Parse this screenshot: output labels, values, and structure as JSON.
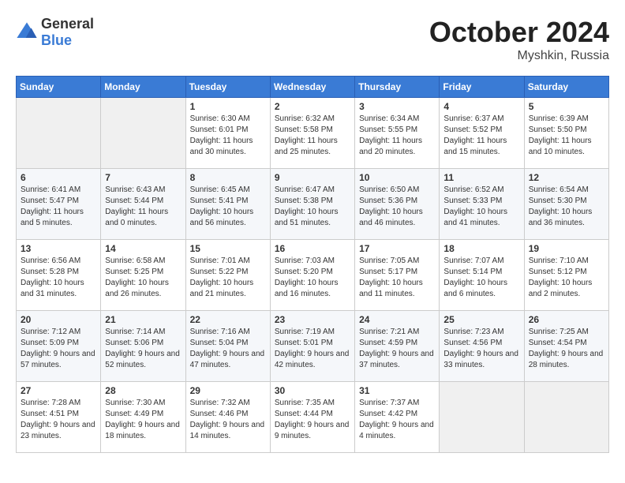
{
  "header": {
    "logo_general": "General",
    "logo_blue": "Blue",
    "month": "October 2024",
    "location": "Myshkin, Russia"
  },
  "days_of_week": [
    "Sunday",
    "Monday",
    "Tuesday",
    "Wednesday",
    "Thursday",
    "Friday",
    "Saturday"
  ],
  "weeks": [
    [
      {
        "day": "",
        "empty": true
      },
      {
        "day": "",
        "empty": true
      },
      {
        "day": "1",
        "sunrise": "Sunrise: 6:30 AM",
        "sunset": "Sunset: 6:01 PM",
        "daylight": "Daylight: 11 hours and 30 minutes."
      },
      {
        "day": "2",
        "sunrise": "Sunrise: 6:32 AM",
        "sunset": "Sunset: 5:58 PM",
        "daylight": "Daylight: 11 hours and 25 minutes."
      },
      {
        "day": "3",
        "sunrise": "Sunrise: 6:34 AM",
        "sunset": "Sunset: 5:55 PM",
        "daylight": "Daylight: 11 hours and 20 minutes."
      },
      {
        "day": "4",
        "sunrise": "Sunrise: 6:37 AM",
        "sunset": "Sunset: 5:52 PM",
        "daylight": "Daylight: 11 hours and 15 minutes."
      },
      {
        "day": "5",
        "sunrise": "Sunrise: 6:39 AM",
        "sunset": "Sunset: 5:50 PM",
        "daylight": "Daylight: 11 hours and 10 minutes."
      }
    ],
    [
      {
        "day": "6",
        "sunrise": "Sunrise: 6:41 AM",
        "sunset": "Sunset: 5:47 PM",
        "daylight": "Daylight: 11 hours and 5 minutes."
      },
      {
        "day": "7",
        "sunrise": "Sunrise: 6:43 AM",
        "sunset": "Sunset: 5:44 PM",
        "daylight": "Daylight: 11 hours and 0 minutes."
      },
      {
        "day": "8",
        "sunrise": "Sunrise: 6:45 AM",
        "sunset": "Sunset: 5:41 PM",
        "daylight": "Daylight: 10 hours and 56 minutes."
      },
      {
        "day": "9",
        "sunrise": "Sunrise: 6:47 AM",
        "sunset": "Sunset: 5:38 PM",
        "daylight": "Daylight: 10 hours and 51 minutes."
      },
      {
        "day": "10",
        "sunrise": "Sunrise: 6:50 AM",
        "sunset": "Sunset: 5:36 PM",
        "daylight": "Daylight: 10 hours and 46 minutes."
      },
      {
        "day": "11",
        "sunrise": "Sunrise: 6:52 AM",
        "sunset": "Sunset: 5:33 PM",
        "daylight": "Daylight: 10 hours and 41 minutes."
      },
      {
        "day": "12",
        "sunrise": "Sunrise: 6:54 AM",
        "sunset": "Sunset: 5:30 PM",
        "daylight": "Daylight: 10 hours and 36 minutes."
      }
    ],
    [
      {
        "day": "13",
        "sunrise": "Sunrise: 6:56 AM",
        "sunset": "Sunset: 5:28 PM",
        "daylight": "Daylight: 10 hours and 31 minutes."
      },
      {
        "day": "14",
        "sunrise": "Sunrise: 6:58 AM",
        "sunset": "Sunset: 5:25 PM",
        "daylight": "Daylight: 10 hours and 26 minutes."
      },
      {
        "day": "15",
        "sunrise": "Sunrise: 7:01 AM",
        "sunset": "Sunset: 5:22 PM",
        "daylight": "Daylight: 10 hours and 21 minutes."
      },
      {
        "day": "16",
        "sunrise": "Sunrise: 7:03 AM",
        "sunset": "Sunset: 5:20 PM",
        "daylight": "Daylight: 10 hours and 16 minutes."
      },
      {
        "day": "17",
        "sunrise": "Sunrise: 7:05 AM",
        "sunset": "Sunset: 5:17 PM",
        "daylight": "Daylight: 10 hours and 11 minutes."
      },
      {
        "day": "18",
        "sunrise": "Sunrise: 7:07 AM",
        "sunset": "Sunset: 5:14 PM",
        "daylight": "Daylight: 10 hours and 6 minutes."
      },
      {
        "day": "19",
        "sunrise": "Sunrise: 7:10 AM",
        "sunset": "Sunset: 5:12 PM",
        "daylight": "Daylight: 10 hours and 2 minutes."
      }
    ],
    [
      {
        "day": "20",
        "sunrise": "Sunrise: 7:12 AM",
        "sunset": "Sunset: 5:09 PM",
        "daylight": "Daylight: 9 hours and 57 minutes."
      },
      {
        "day": "21",
        "sunrise": "Sunrise: 7:14 AM",
        "sunset": "Sunset: 5:06 PM",
        "daylight": "Daylight: 9 hours and 52 minutes."
      },
      {
        "day": "22",
        "sunrise": "Sunrise: 7:16 AM",
        "sunset": "Sunset: 5:04 PM",
        "daylight": "Daylight: 9 hours and 47 minutes."
      },
      {
        "day": "23",
        "sunrise": "Sunrise: 7:19 AM",
        "sunset": "Sunset: 5:01 PM",
        "daylight": "Daylight: 9 hours and 42 minutes."
      },
      {
        "day": "24",
        "sunrise": "Sunrise: 7:21 AM",
        "sunset": "Sunset: 4:59 PM",
        "daylight": "Daylight: 9 hours and 37 minutes."
      },
      {
        "day": "25",
        "sunrise": "Sunrise: 7:23 AM",
        "sunset": "Sunset: 4:56 PM",
        "daylight": "Daylight: 9 hours and 33 minutes."
      },
      {
        "day": "26",
        "sunrise": "Sunrise: 7:25 AM",
        "sunset": "Sunset: 4:54 PM",
        "daylight": "Daylight: 9 hours and 28 minutes."
      }
    ],
    [
      {
        "day": "27",
        "sunrise": "Sunrise: 7:28 AM",
        "sunset": "Sunset: 4:51 PM",
        "daylight": "Daylight: 9 hours and 23 minutes."
      },
      {
        "day": "28",
        "sunrise": "Sunrise: 7:30 AM",
        "sunset": "Sunset: 4:49 PM",
        "daylight": "Daylight: 9 hours and 18 minutes."
      },
      {
        "day": "29",
        "sunrise": "Sunrise: 7:32 AM",
        "sunset": "Sunset: 4:46 PM",
        "daylight": "Daylight: 9 hours and 14 minutes."
      },
      {
        "day": "30",
        "sunrise": "Sunrise: 7:35 AM",
        "sunset": "Sunset: 4:44 PM",
        "daylight": "Daylight: 9 hours and 9 minutes."
      },
      {
        "day": "31",
        "sunrise": "Sunrise: 7:37 AM",
        "sunset": "Sunset: 4:42 PM",
        "daylight": "Daylight: 9 hours and 4 minutes."
      },
      {
        "day": "",
        "empty": true
      },
      {
        "day": "",
        "empty": true
      }
    ]
  ]
}
